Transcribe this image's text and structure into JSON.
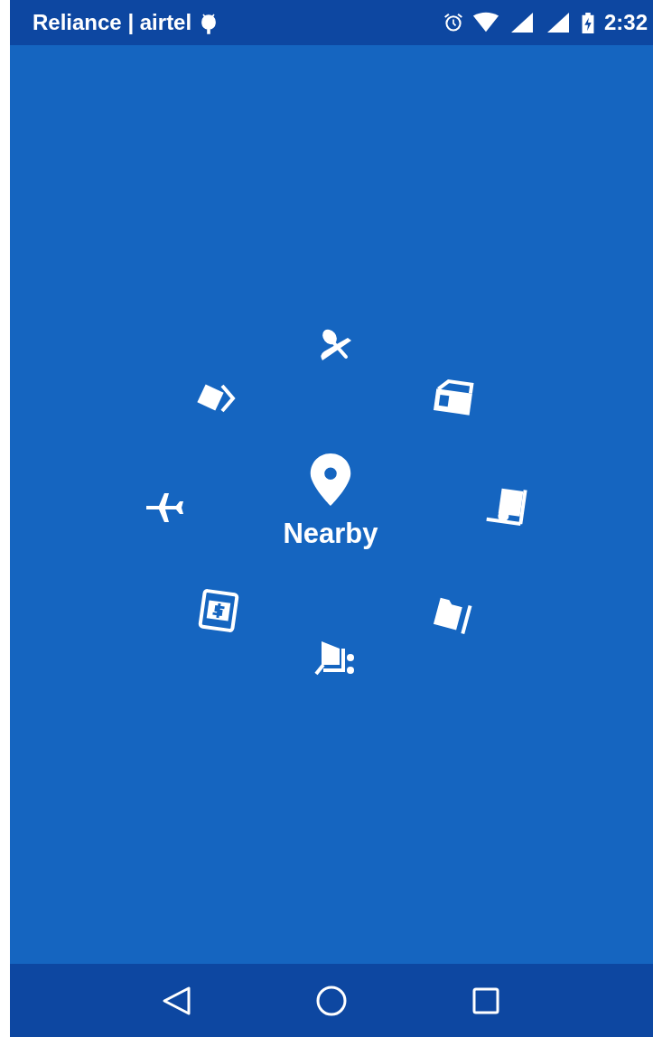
{
  "status_bar": {
    "carrier": "Reliance | airtel",
    "time": "2:32"
  },
  "center": {
    "label": "Nearby"
  }
}
